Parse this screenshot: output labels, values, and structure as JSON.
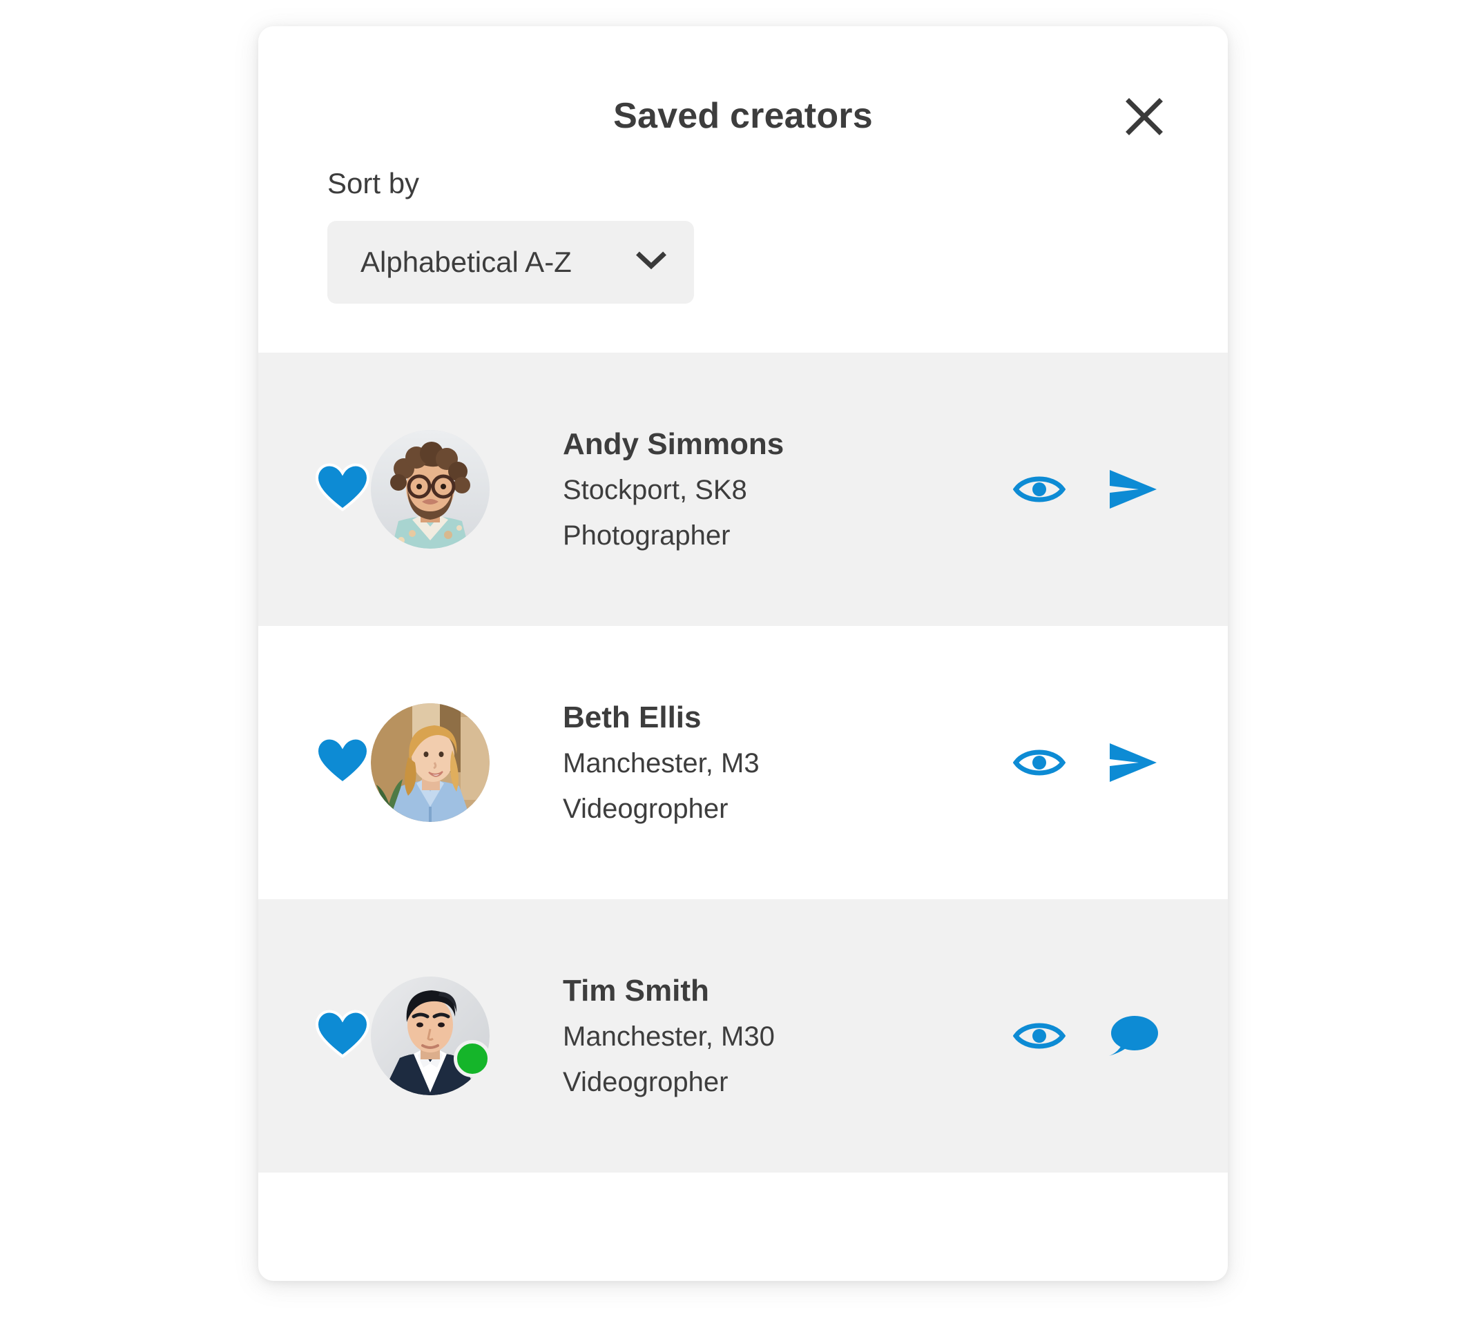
{
  "modal": {
    "title": "Saved creators",
    "close_label": "close-icon",
    "accent_color": "#0d8bd4",
    "text_color": "#3d3d3d",
    "shaded_row_color": "#f1f1f1",
    "online_color": "#15b52a"
  },
  "sort": {
    "label": "Sort by",
    "selected": "Alphabetical A-Z",
    "options": [
      "Alphabetical A-Z"
    ]
  },
  "creators": [
    {
      "name": "Andy Simmons",
      "location": "Stockport, SK8",
      "role": "Photographer",
      "favourited": true,
      "online": false,
      "actions": [
        "view-icon",
        "send-icon"
      ]
    },
    {
      "name": "Beth Ellis",
      "location": "Manchester, M3",
      "role": "Videogropher",
      "favourited": true,
      "online": false,
      "actions": [
        "view-icon",
        "send-icon"
      ]
    },
    {
      "name": "Tim Smith",
      "location": "Manchester, M30",
      "role": "Videogropher",
      "favourited": true,
      "online": true,
      "actions": [
        "view-icon",
        "message-icon"
      ]
    }
  ]
}
